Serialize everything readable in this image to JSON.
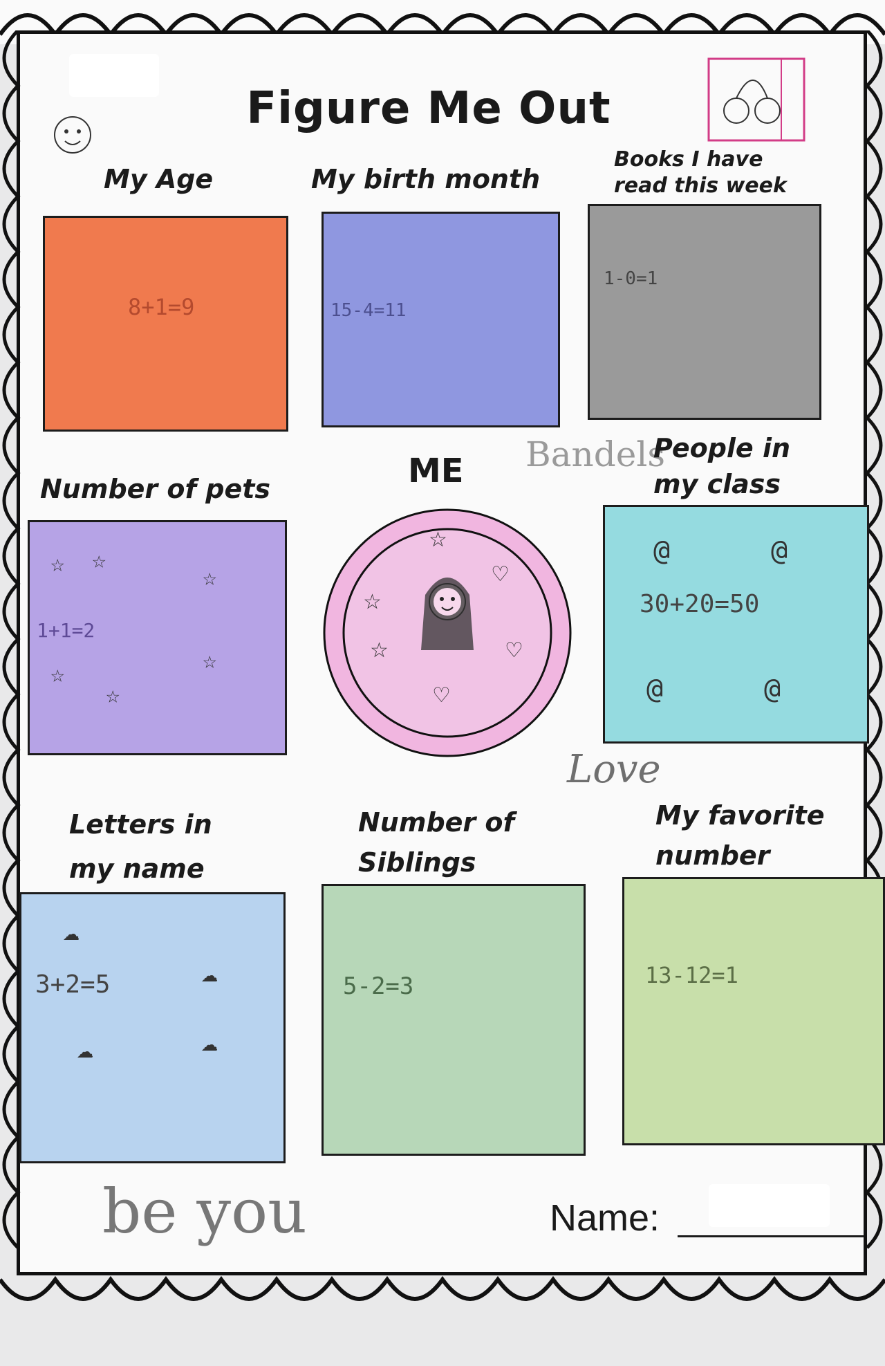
{
  "worksheet": {
    "title": "Figure Me Out",
    "center_label": "ME",
    "name_label": "Name:",
    "colors": {
      "age": "#f07a4e",
      "birth_month": "#8f97e0",
      "books": "#9a9a9a",
      "pets": "#b6a3e6",
      "class": "#95dbe0",
      "letters": "#b8d3ef",
      "siblings": "#b7d7b8",
      "favorite": "#c8dfaa",
      "me_circle": "#f1b6e0"
    },
    "boxes": [
      {
        "label": "My Age",
        "answer": "8+1=9"
      },
      {
        "label": "My birth month",
        "answer": "15-4=11"
      },
      {
        "label": "Books I have read this week",
        "answer": "1-0=1"
      },
      {
        "label": "Number of pets",
        "answer": "1+1=2"
      },
      {
        "label": "People in my class",
        "answer": "30+20=50"
      },
      {
        "label": "Letters in my name",
        "answer": "3+2=5"
      },
      {
        "label": "Number of Siblings",
        "answer": "5-2=3"
      },
      {
        "label": "My favorite number",
        "answer": "13-12=1"
      }
    ],
    "handwriting": {
      "banner": "Bandels",
      "love": "Love",
      "be_you": "be you"
    }
  }
}
